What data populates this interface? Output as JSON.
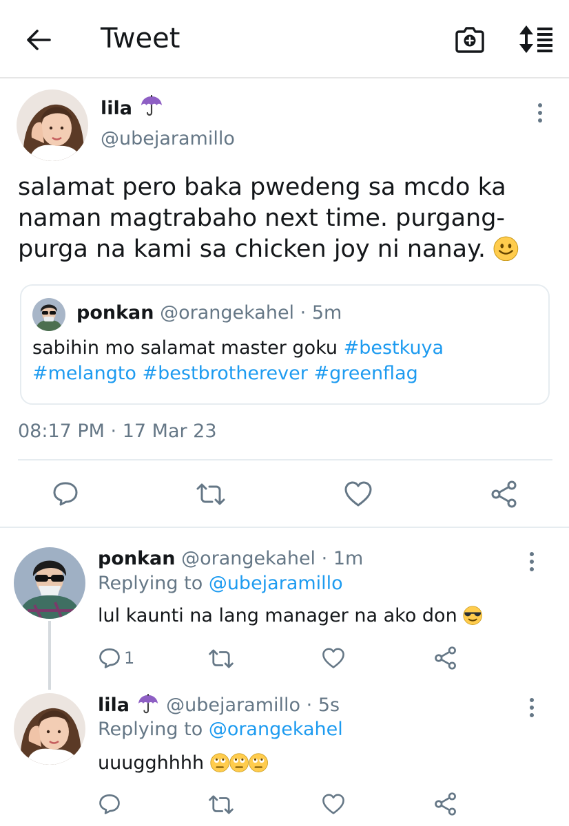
{
  "header": {
    "title": "Tweet",
    "back_icon": "arrow-left-icon",
    "camera_icon": "camera-plus-icon",
    "sort_icon": "sort-updown-icon"
  },
  "main_tweet": {
    "display_name": "lila",
    "name_emoji": "☂",
    "handle": "@ubejaramillo",
    "text": "salamat pero baka pwedeng sa mcdo ka naman magtrabaho next time. purgang-purga na kami sa chicken joy ni nanay.",
    "text_emoji": "🙂",
    "timestamp": "08:17 PM · 17 Mar 23",
    "quote": {
      "display_name": "ponkan",
      "handle": "@orangekahel",
      "time": "· 5m",
      "text": "sabihin mo salamat master goku",
      "hashtags": [
        "#bestkuya",
        "#melangto",
        "#bestbrotherever",
        "#greenflag"
      ]
    }
  },
  "replies": [
    {
      "display_name": "ponkan",
      "handle": "@orangekahel",
      "time": "· 1m",
      "replying_prefix": "Replying to",
      "replying_to": "@ubejaramillo",
      "text": "lul kaunti na lang manager na ako don",
      "emoji": "😎",
      "reply_count": "1"
    },
    {
      "display_name": "lila",
      "name_emoji": "☂",
      "handle": "@ubejaramillo",
      "time": "· 5s",
      "replying_prefix": "Replying to",
      "replying_to": "@orangekahel",
      "text": "uuugghhhh",
      "emoji": "🙄🙄🙄",
      "reply_count": ""
    }
  ],
  "colors": {
    "link": "#1d9bf0",
    "muted": "#657786",
    "text": "#14171a",
    "umbrella": "#8e5fc4"
  }
}
